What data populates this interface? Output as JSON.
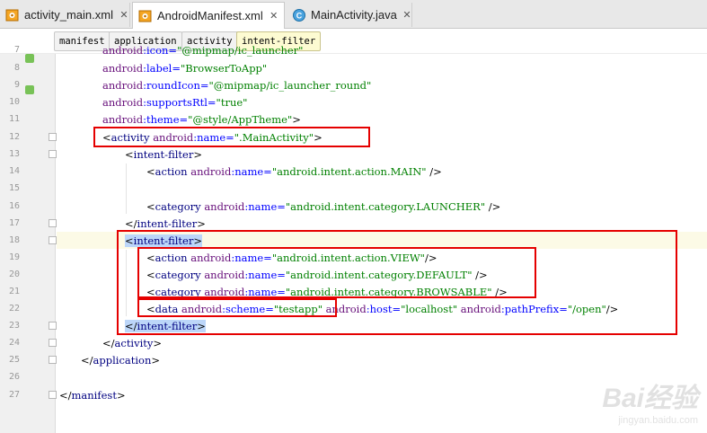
{
  "tabs": [
    {
      "label": "activity_main.xml",
      "icon": "xml-layout-icon"
    },
    {
      "label": "AndroidManifest.xml",
      "icon": "xml-manifest-icon"
    },
    {
      "label": "MainActivity.java",
      "icon": "java-class-icon"
    }
  ],
  "breadcrumb": [
    "manifest",
    "application",
    "activity",
    "intent-filter"
  ],
  "editor": {
    "lines": [
      {
        "n": "7"
      },
      {
        "n": "8"
      },
      {
        "n": "9"
      },
      {
        "n": "10"
      },
      {
        "n": "11"
      },
      {
        "n": "12"
      },
      {
        "n": "13"
      },
      {
        "n": "14"
      },
      {
        "n": "15"
      },
      {
        "n": "16"
      },
      {
        "n": "17"
      },
      {
        "n": "18"
      },
      {
        "n": "19"
      },
      {
        "n": "20"
      },
      {
        "n": "21"
      },
      {
        "n": "22"
      },
      {
        "n": "23"
      },
      {
        "n": "24"
      },
      {
        "n": "25"
      },
      {
        "n": "26"
      },
      {
        "n": "27"
      }
    ]
  },
  "watermark": {
    "brand": "Bai经验",
    "url": "jingyan.baidu.com"
  },
  "colors": {
    "tag": "#000080",
    "namespace": "#660e7a",
    "attribute": "#0000ff",
    "value": "#008000",
    "highlight_box": "#e50000",
    "selection": "#bcd6f9"
  }
}
